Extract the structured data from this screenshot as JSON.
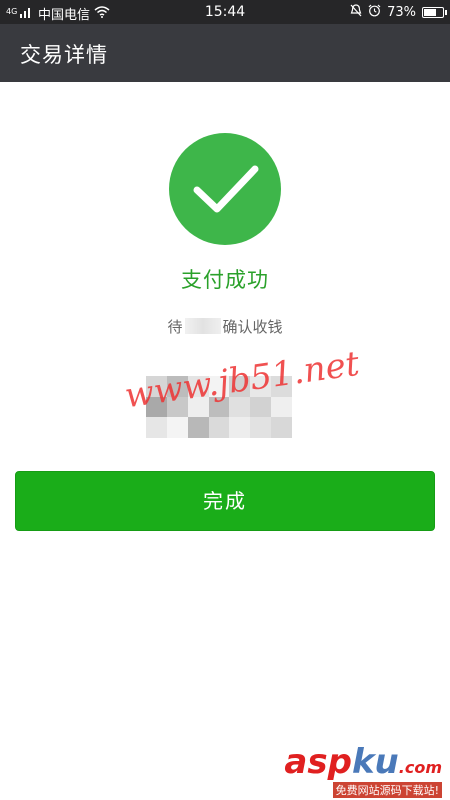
{
  "status_bar": {
    "signal": "4G",
    "carrier": "中国电信",
    "time": "15:44",
    "battery": "73%",
    "battery_level": 0.73
  },
  "header": {
    "title": "交易详情"
  },
  "result": {
    "status": "支付成功",
    "confirm_prefix": "待",
    "confirm_suffix": "确认收钱"
  },
  "actions": {
    "done_label": "完成"
  },
  "watermarks": {
    "jb51": "www.jb51.net",
    "logo_part1": "asp",
    "logo_part2": "ku",
    "logo_part3": ".com",
    "tagline": "免费网站源码下载站!"
  },
  "colors": {
    "accent_green": "#1aad19",
    "success_circle": "#3eb64a",
    "success_text": "#2aa12a",
    "title_bar": "#393a3f"
  },
  "icons": [
    "signal-icon",
    "wifi-icon",
    "mute-icon",
    "alarm-icon",
    "battery-icon",
    "checkmark-icon"
  ]
}
